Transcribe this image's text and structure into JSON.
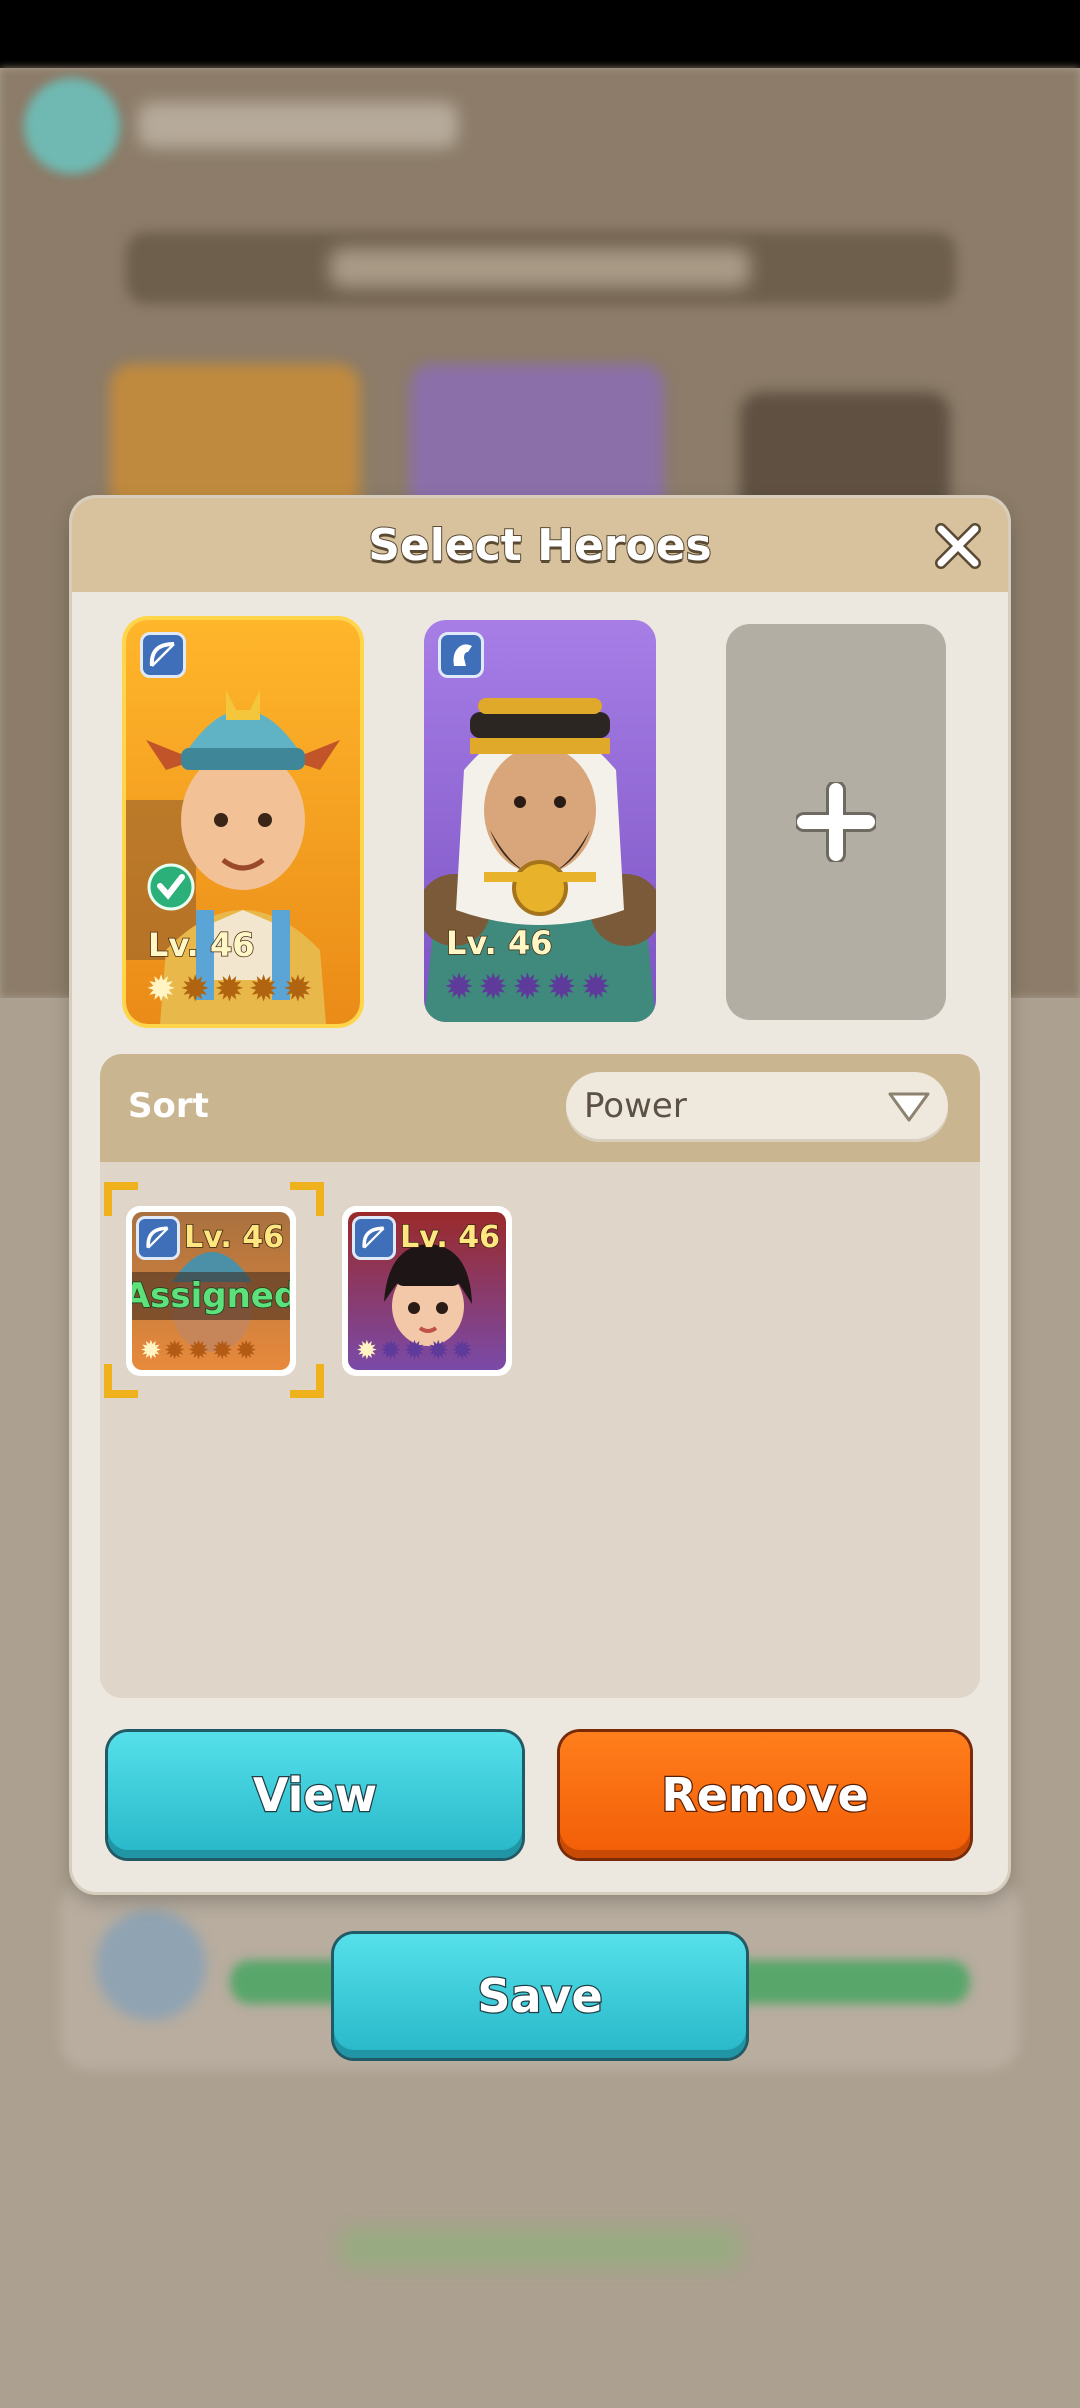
{
  "modal": {
    "title": "Select Heroes",
    "close_icon": "close-icon"
  },
  "selected_heroes": [
    {
      "level": "Lv. 46",
      "rarity_color": "#f0a21e",
      "class_icon": "bow-icon",
      "stars_filled": 1,
      "stars_total": 5
    },
    {
      "level": "Lv. 46",
      "rarity_color": "#8b62d4",
      "class_icon": "horse-icon",
      "stars_filled": 0,
      "stars_total": 5
    }
  ],
  "add_slot": {
    "icon": "plus-icon"
  },
  "sort": {
    "label": "Sort",
    "selected": "Power",
    "arrow_icon": "chevron-down-icon"
  },
  "hero_list": [
    {
      "level": "Lv. 46",
      "status": "Assigned",
      "class_icon": "bow-icon",
      "stars_filled": 1,
      "stars_total": 5,
      "selected": true
    },
    {
      "level": "Lv. 46",
      "status": "",
      "class_icon": "bow-icon",
      "stars_filled": 1,
      "stars_total": 5,
      "selected": false
    }
  ],
  "buttons": {
    "view": "View",
    "remove": "Remove",
    "save": "Save"
  },
  "colors": {
    "accent_teal": "#33c6d6",
    "accent_orange": "#f5660b",
    "assigned_green": "#5ee07a"
  }
}
